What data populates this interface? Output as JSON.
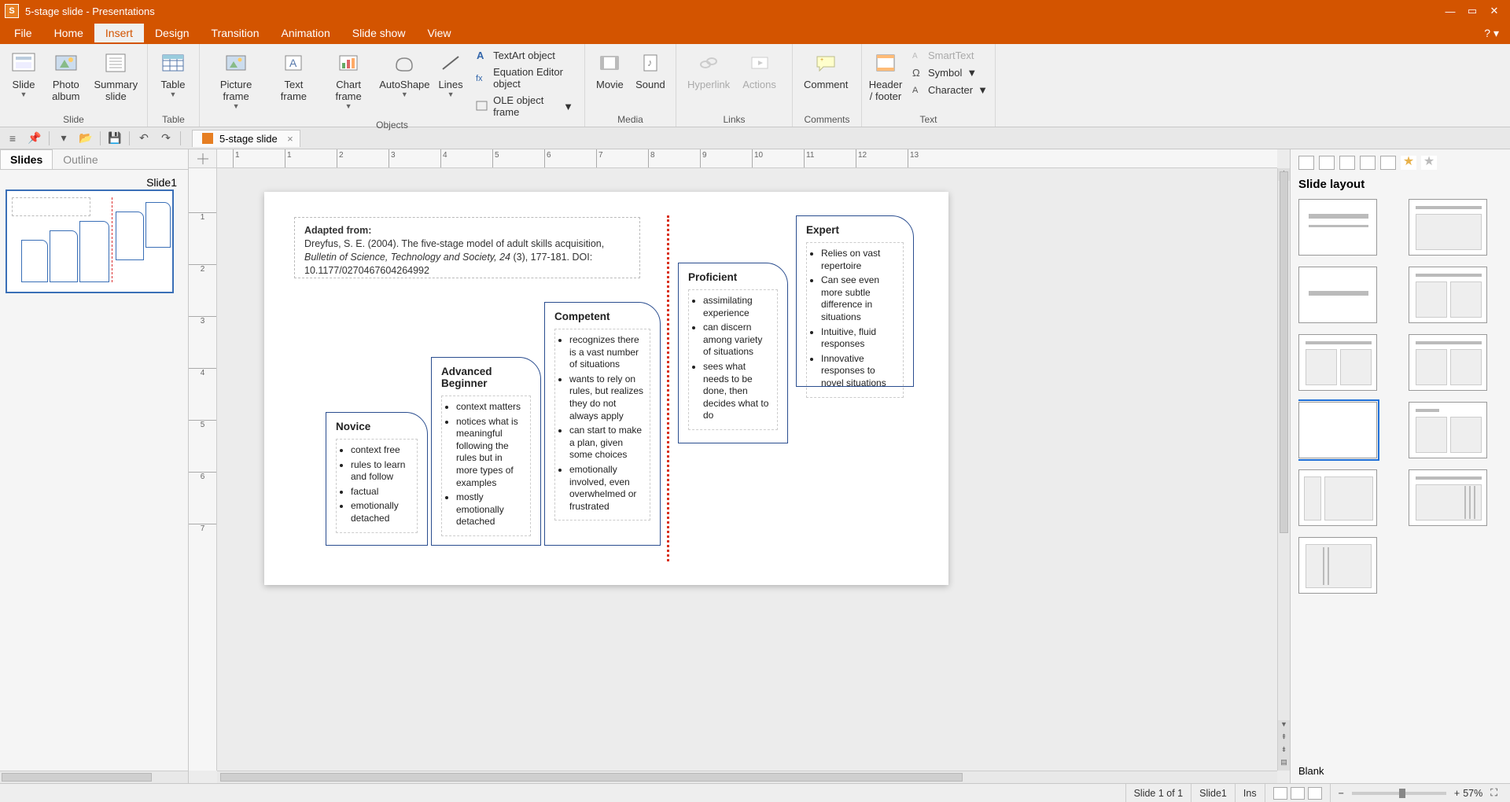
{
  "window": {
    "title": "5-stage slide - Presentations",
    "app_initial": "S"
  },
  "menus": [
    "File",
    "Home",
    "Insert",
    "Design",
    "Transition",
    "Animation",
    "Slide show",
    "View"
  ],
  "active_menu": "Insert",
  "ribbon": {
    "groups": [
      {
        "label": "Slide",
        "buttons": [
          {
            "name": "slide",
            "label": "Slide",
            "caret": true
          },
          {
            "name": "photo-album",
            "label": "Photo album"
          },
          {
            "name": "summary-slide",
            "label": "Summary slide"
          }
        ]
      },
      {
        "label": "Table",
        "buttons": [
          {
            "name": "table",
            "label": "Table",
            "caret": true
          }
        ]
      },
      {
        "label": "Objects",
        "buttons": [
          {
            "name": "picture-frame",
            "label": "Picture frame",
            "caret": true
          },
          {
            "name": "text-frame",
            "label": "Text frame"
          },
          {
            "name": "chart-frame",
            "label": "Chart frame",
            "caret": true
          },
          {
            "name": "autoshape",
            "label": "AutoShape",
            "caret": true
          },
          {
            "name": "lines",
            "label": "Lines",
            "caret": true
          }
        ],
        "small": [
          {
            "name": "textart",
            "label": "TextArt object"
          },
          {
            "name": "equation",
            "label": "Equation Editor object"
          },
          {
            "name": "ole",
            "label": "OLE object frame",
            "caret": true
          }
        ]
      },
      {
        "label": "Media",
        "buttons": [
          {
            "name": "movie",
            "label": "Movie"
          },
          {
            "name": "sound",
            "label": "Sound"
          }
        ]
      },
      {
        "label": "Links",
        "buttons": [
          {
            "name": "hyperlink",
            "label": "Hyperlink",
            "disabled": true
          },
          {
            "name": "actions",
            "label": "Actions",
            "disabled": true
          }
        ]
      },
      {
        "label": "Comments",
        "buttons": [
          {
            "name": "comment",
            "label": "Comment"
          }
        ]
      },
      {
        "label": "Text",
        "buttons": [
          {
            "name": "header-footer",
            "label": "Header / footer"
          }
        ],
        "small": [
          {
            "name": "smarttext",
            "label": "SmartText",
            "disabled": true
          },
          {
            "name": "symbol",
            "label": "Symbol",
            "caret": true
          },
          {
            "name": "character",
            "label": "Character",
            "caret": true
          }
        ]
      }
    ]
  },
  "doc_tab": "5-stage slide",
  "left_tabs": {
    "slides": "Slides",
    "outline": "Outline",
    "active": "Slides"
  },
  "thumb_label": "Slide1",
  "ruler_h_numbers": [
    "1",
    "1",
    "2",
    "3",
    "4",
    "5",
    "6",
    "7",
    "8",
    "9",
    "10",
    "11",
    "12",
    "13"
  ],
  "ruler_v_numbers": [
    "1",
    "2",
    "3",
    "4",
    "5",
    "6",
    "7"
  ],
  "reference": {
    "title": "Adapted from:",
    "line1": "Dreyfus, S. E. (2004).  The five-stage model of adult skills acquisition,",
    "journal": "Bulletin of Science, Technology and Society, 24",
    "line2_tail": " (3), 177-181. DOI: 10.1177/0270467604264992"
  },
  "stages": {
    "novice": {
      "title": "Novice",
      "bullets": [
        "context free",
        "rules to learn and follow",
        "factual",
        "emotionally detached"
      ]
    },
    "advanced": {
      "title": "Advanced Beginner",
      "bullets": [
        "context matters",
        "notices what is meaningful following the rules but in more types of examples",
        "mostly emotionally detached"
      ]
    },
    "competent": {
      "title": "Competent",
      "bullets": [
        "recognizes there is a vast number of situations",
        "wants to rely on rules, but realizes they do not always apply",
        "can start to make a plan, given some choices",
        "emotionally involved, even overwhelmed or frustrated"
      ]
    },
    "proficient": {
      "title": "Proficient",
      "bullets": [
        "assimilating experience",
        "can discern among variety of situations",
        "sees what needs to be done, then decides what to do"
      ]
    },
    "expert": {
      "title": "Expert",
      "bullets": [
        "Relies on vast repertoire",
        "Can see even more subtle difference in situations",
        "Intuitive, fluid responses",
        "Innovative responses to novel situations"
      ]
    }
  },
  "right_panel": {
    "title": "Slide layout",
    "footer": "Blank",
    "selected_index": 6
  },
  "statusbar": {
    "slide_of": "Slide 1 of 1",
    "slide_name": "Slide1",
    "ins": "Ins",
    "zoom": "57%"
  }
}
